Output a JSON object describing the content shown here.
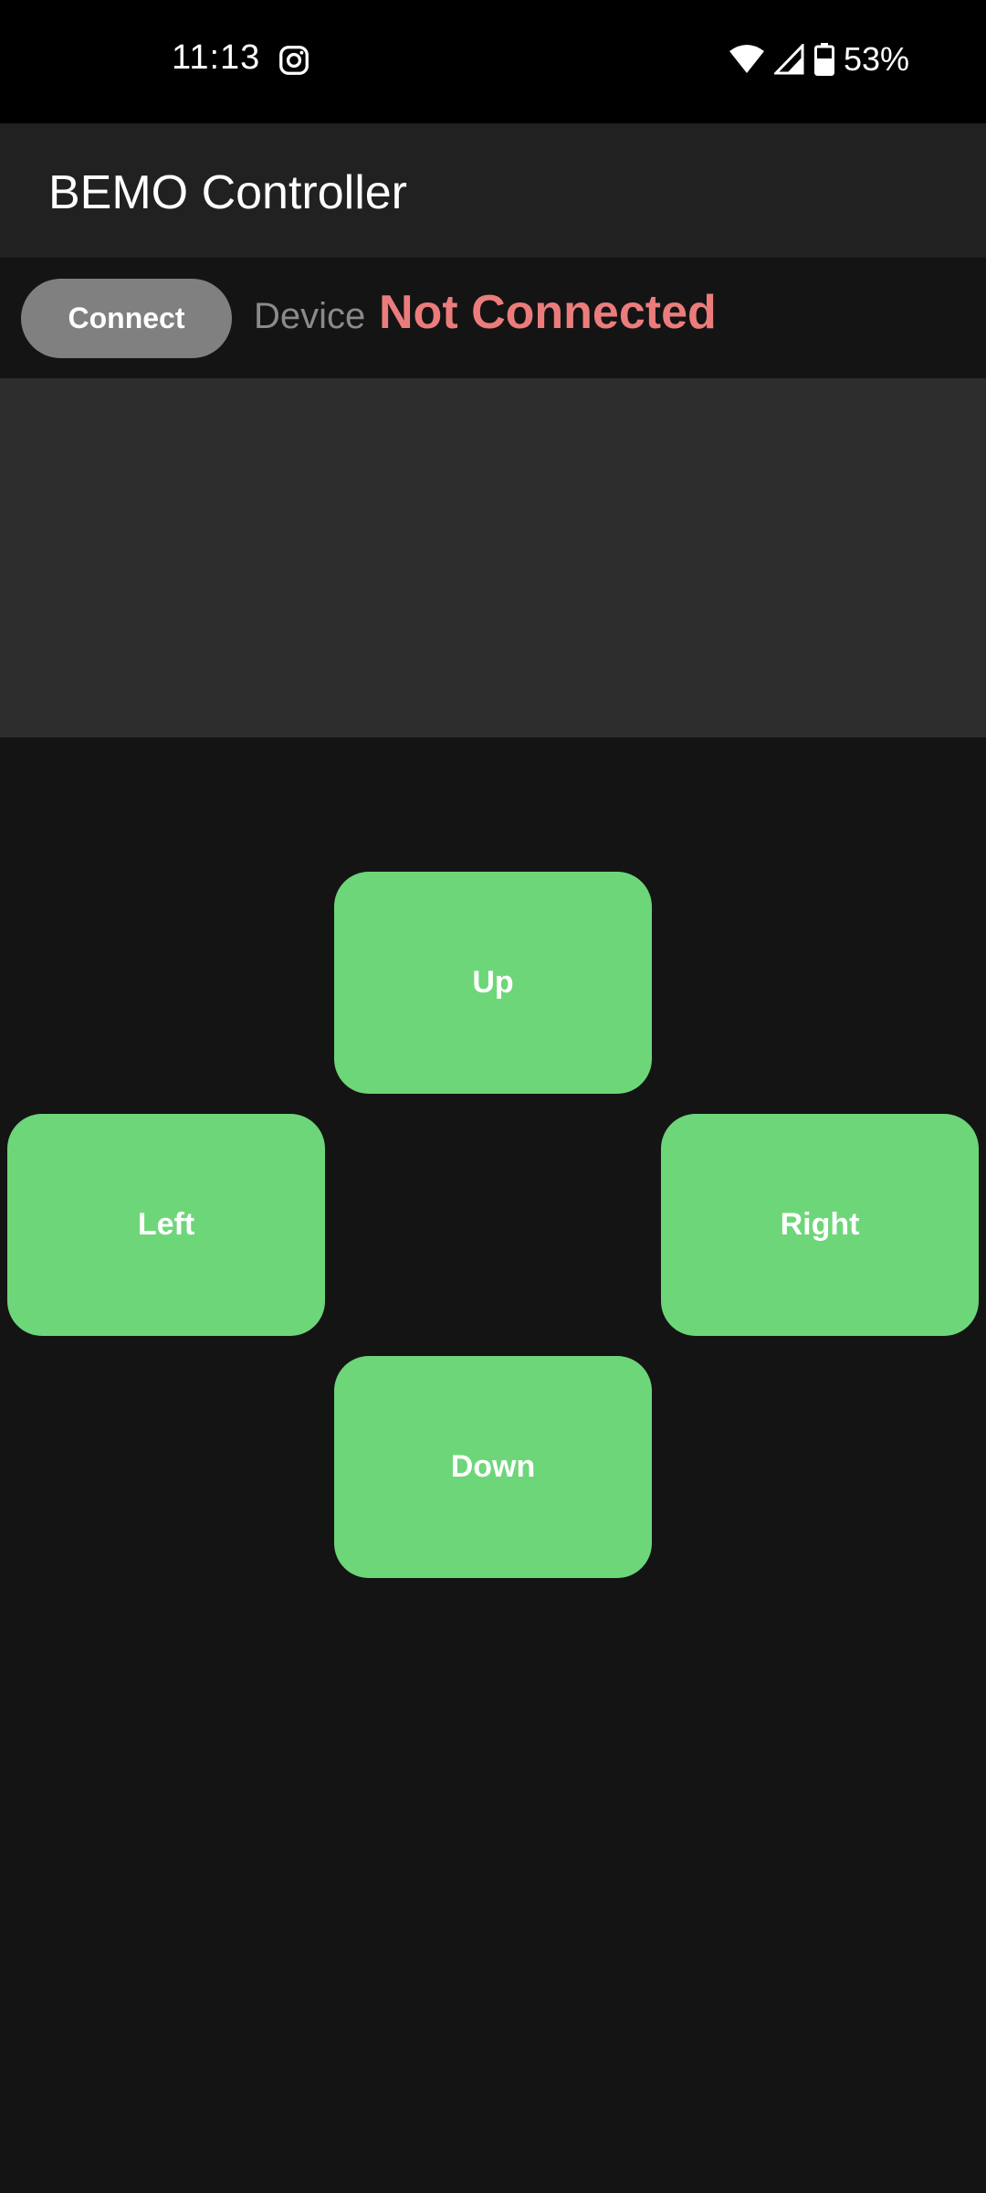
{
  "status_bar": {
    "time": "11:13",
    "battery": "53%",
    "icons": [
      "instagram-icon",
      "wifi-icon",
      "cell-signal-icon",
      "battery-icon"
    ]
  },
  "app_bar": {
    "title": "BEMO Controller"
  },
  "connection": {
    "connect_label": "Connect",
    "device_label": "Device",
    "device_status": "Not Connected",
    "status_color": "#ec7c7c"
  },
  "controls": {
    "up": "Up",
    "left": "Left",
    "right": "Right",
    "down": "Down",
    "button_color": "#6dd679"
  }
}
